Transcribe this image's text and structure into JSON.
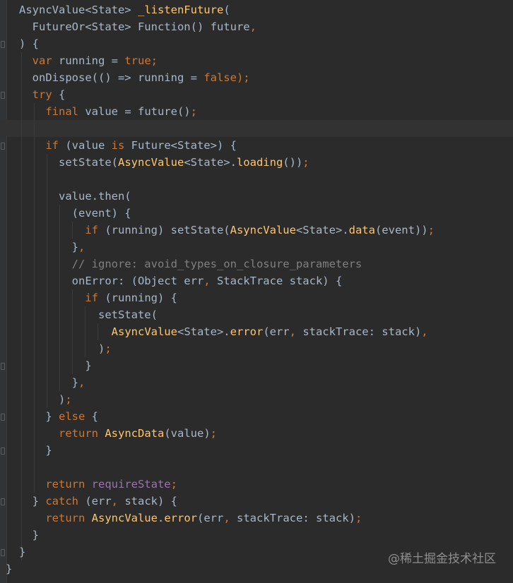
{
  "lines": [
    {
      "tokens": [
        {
          "t": "AsyncValue<State> ",
          "c": "id"
        },
        {
          "t": "_listenFuture",
          "c": "fn"
        },
        {
          "t": "(",
          "c": "id"
        }
      ]
    },
    {
      "tokens": [
        {
          "t": "  FutureOr<State> Function() future",
          "c": "id"
        },
        {
          "t": ",",
          "c": "kw"
        }
      ]
    },
    {
      "tokens": [
        {
          "t": ") {",
          "c": "id"
        }
      ]
    },
    {
      "tokens": [
        {
          "t": "  ",
          "c": "id"
        },
        {
          "t": "var ",
          "c": "kw"
        },
        {
          "t": "running = ",
          "c": "id"
        },
        {
          "t": "true",
          "c": "kw"
        },
        {
          "t": ";",
          "c": "kw"
        }
      ]
    },
    {
      "tokens": [
        {
          "t": "  onDispose(() => running = ",
          "c": "id"
        },
        {
          "t": "false",
          "c": "kw"
        },
        {
          "t": ");",
          "c": "kw"
        }
      ]
    },
    {
      "tokens": [
        {
          "t": "  ",
          "c": "id"
        },
        {
          "t": "try ",
          "c": "kw"
        },
        {
          "t": "{",
          "c": "id"
        }
      ]
    },
    {
      "tokens": [
        {
          "t": "    ",
          "c": "id"
        },
        {
          "t": "final ",
          "c": "kw"
        },
        {
          "t": "value = future()",
          "c": "id"
        },
        {
          "t": ";",
          "c": "kw"
        }
      ]
    },
    {
      "tokens": []
    },
    {
      "tokens": [
        {
          "t": "    ",
          "c": "id"
        },
        {
          "t": "if ",
          "c": "kw"
        },
        {
          "t": "(value ",
          "c": "id"
        },
        {
          "t": "is ",
          "c": "kw"
        },
        {
          "t": "Future<State>) {",
          "c": "id"
        }
      ]
    },
    {
      "tokens": [
        {
          "t": "      setState(",
          "c": "id"
        },
        {
          "t": "AsyncValue",
          "c": "fn"
        },
        {
          "t": "<State>.",
          "c": "id"
        },
        {
          "t": "loading",
          "c": "fn"
        },
        {
          "t": "())",
          "c": "id"
        },
        {
          "t": ";",
          "c": "kw"
        }
      ]
    },
    {
      "tokens": []
    },
    {
      "tokens": [
        {
          "t": "      value.then(",
          "c": "id"
        }
      ]
    },
    {
      "tokens": [
        {
          "t": "        (event) {",
          "c": "id"
        }
      ]
    },
    {
      "tokens": [
        {
          "t": "          ",
          "c": "id"
        },
        {
          "t": "if ",
          "c": "kw"
        },
        {
          "t": "(running) setState(",
          "c": "id"
        },
        {
          "t": "AsyncValue",
          "c": "fn"
        },
        {
          "t": "<State>.",
          "c": "id"
        },
        {
          "t": "data",
          "c": "fn"
        },
        {
          "t": "(event))",
          "c": "id"
        },
        {
          "t": ";",
          "c": "kw"
        }
      ]
    },
    {
      "tokens": [
        {
          "t": "        }",
          "c": "id"
        },
        {
          "t": ",",
          "c": "kw"
        }
      ]
    },
    {
      "tokens": [
        {
          "t": "        // ignore: avoid_types_on_closure_parameters",
          "c": "cmt"
        }
      ]
    },
    {
      "tokens": [
        {
          "t": "        onError: (Object err",
          "c": "id"
        },
        {
          "t": ", ",
          "c": "kw"
        },
        {
          "t": "StackTrace stack) {",
          "c": "id"
        }
      ]
    },
    {
      "tokens": [
        {
          "t": "          ",
          "c": "id"
        },
        {
          "t": "if ",
          "c": "kw"
        },
        {
          "t": "(running) {",
          "c": "id"
        }
      ]
    },
    {
      "tokens": [
        {
          "t": "            setState(",
          "c": "id"
        }
      ]
    },
    {
      "tokens": [
        {
          "t": "              ",
          "c": "id"
        },
        {
          "t": "AsyncValue",
          "c": "fn"
        },
        {
          "t": "<State>.",
          "c": "id"
        },
        {
          "t": "error",
          "c": "fn"
        },
        {
          "t": "(err",
          "c": "id"
        },
        {
          "t": ", ",
          "c": "kw"
        },
        {
          "t": "stackTrace: stack)",
          "c": "id"
        },
        {
          "t": ",",
          "c": "kw"
        }
      ]
    },
    {
      "tokens": [
        {
          "t": "            )",
          "c": "id"
        },
        {
          "t": ";",
          "c": "kw"
        }
      ]
    },
    {
      "tokens": [
        {
          "t": "          }",
          "c": "id"
        }
      ]
    },
    {
      "tokens": [
        {
          "t": "        }",
          "c": "id"
        },
        {
          "t": ",",
          "c": "kw"
        }
      ]
    },
    {
      "tokens": [
        {
          "t": "      )",
          "c": "id"
        },
        {
          "t": ";",
          "c": "kw"
        }
      ]
    },
    {
      "tokens": [
        {
          "t": "    } ",
          "c": "id"
        },
        {
          "t": "else ",
          "c": "kw"
        },
        {
          "t": "{",
          "c": "id"
        }
      ]
    },
    {
      "tokens": [
        {
          "t": "      ",
          "c": "id"
        },
        {
          "t": "return ",
          "c": "kw"
        },
        {
          "t": "AsyncData",
          "c": "fn"
        },
        {
          "t": "(value)",
          "c": "id"
        },
        {
          "t": ";",
          "c": "kw"
        }
      ]
    },
    {
      "tokens": [
        {
          "t": "    }",
          "c": "id"
        }
      ]
    },
    {
      "tokens": []
    },
    {
      "tokens": [
        {
          "t": "    ",
          "c": "id"
        },
        {
          "t": "return ",
          "c": "kw"
        },
        {
          "t": "requireState",
          "c": "prop"
        },
        {
          "t": ";",
          "c": "kw"
        }
      ]
    },
    {
      "tokens": [
        {
          "t": "  } ",
          "c": "id"
        },
        {
          "t": "catch ",
          "c": "kw"
        },
        {
          "t": "(err",
          "c": "id"
        },
        {
          "t": ", ",
          "c": "kw"
        },
        {
          "t": "stack) {",
          "c": "id"
        }
      ]
    },
    {
      "tokens": [
        {
          "t": "    ",
          "c": "id"
        },
        {
          "t": "return ",
          "c": "kw"
        },
        {
          "t": "AsyncValue",
          "c": "fn"
        },
        {
          "t": ".",
          "c": "id"
        },
        {
          "t": "error",
          "c": "fn"
        },
        {
          "t": "(err",
          "c": "id"
        },
        {
          "t": ", ",
          "c": "kw"
        },
        {
          "t": "stackTrace: stack)",
          "c": "id"
        },
        {
          "t": ";",
          "c": "kw"
        }
      ]
    },
    {
      "tokens": [
        {
          "t": "  }",
          "c": "id"
        }
      ]
    },
    {
      "tokens": [
        {
          "t": "}",
          "c": "id"
        }
      ]
    },
    {
      "tokens": [
        {
          "t": "}",
          "c": "id"
        }
      ]
    }
  ],
  "colors": {
    "background": "#2b2b2b",
    "keyword": "#cc7832",
    "function": "#ffc66d",
    "comment": "#808080",
    "property": "#9876aa",
    "identifier": "#a9b7c6"
  },
  "watermark": "@稀土掘金技术社区"
}
